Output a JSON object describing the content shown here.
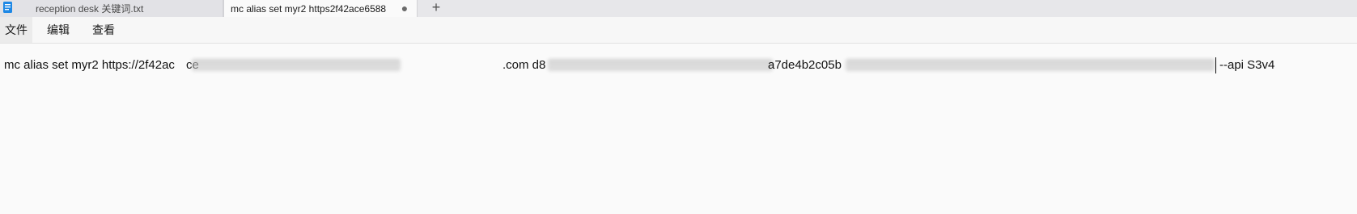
{
  "tabs": [
    {
      "title": "reception desk 关键词.txt",
      "active": false,
      "icon": "notepad-file-icon"
    },
    {
      "title": "mc alias set myr2 https2f42ace6588",
      "active": true,
      "dirty_indicator": "●"
    }
  ],
  "new_tab_label": "+",
  "menu": {
    "file": "文件",
    "edit": "编辑",
    "view": "查看"
  },
  "editor": {
    "segments": {
      "s1": "mc alias set myr2 https://2f42ac",
      "s2": "ce",
      "s3": ".com d8",
      "s4": "a7de4b2c05b",
      "s5": "--api S3v4"
    },
    "redacted": true
  },
  "colors": {
    "tabstrip_bg": "#e7e7ea",
    "active_tab_bg": "#fafafa",
    "editor_bg": "#fafafa",
    "text": "#111111"
  }
}
